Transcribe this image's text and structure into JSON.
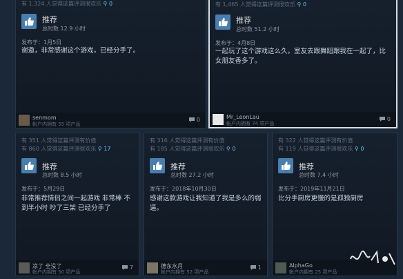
{
  "reviews": [
    {
      "helpful": "有 1,324 人觉得这篇评测很欢乐",
      "award_count": "0",
      "recommend": "推荐",
      "hours": "总时数 12.9 小时",
      "posted": "发布于：1月5日",
      "text": "谢邀，非常感谢这个游戏，已经分手了。",
      "author": "senmom",
      "owned": "帐户内拥有 55 项产品",
      "comments": "0"
    },
    {
      "helpful": "有 1,465 人觉得这篇评测很欢乐",
      "award_count": "0",
      "recommend": "推荐",
      "hours": "总时数 51.2 小时",
      "posted": "发布于：4月8日",
      "text": "一起玩了这个游戏这么久，室友去跟舞蹈跟我在一起了，比女朋友香多了。",
      "author": "Mr_LeonLau",
      "owned": "帐户内拥有 74 项产品",
      "comments": "0"
    },
    {
      "helpful_value": "有 351 人觉得这篇评测有价值",
      "helpful": "有 860 人觉得这篇评测很欢乐",
      "award_count": "17",
      "recommend": "推荐",
      "hours": "总时数 8.5 小时",
      "posted": "发布于：5月29日",
      "text": "非常推荐情侣之间一起游戏 非常棒 不到半小时 吵了三架 已经分手了",
      "author": "凉了 全没了",
      "owned": "帐户内拥有 50 项产品",
      "comments": "7"
    },
    {
      "helpful_value": "有 316 人觉得这篇评测有价值",
      "helpful": "有 185 人觉得这篇评测很欢乐",
      "award_count": "0",
      "recommend": "推荐",
      "hours": "总时数 27.2 小时",
      "posted": "发布于：2018年10月30日",
      "text": "感谢这款游戏让我知道了我是多么的弱逼。",
      "author": "德东水月",
      "owned": "帐户内拥有 52 项产品",
      "comments": "1"
    },
    {
      "helpful_value": "有 322 人觉得这篇评测有价值",
      "helpful": "有 119 人觉得这篇评测很欢乐",
      "award_count": "0",
      "recommend": "推荐",
      "hours": "总时数 7.4 小时",
      "posted": "发布于：2019年11月21日",
      "text": "比分手厨房更慢的是孤独厨房",
      "author": "AlphaGo",
      "owned": "帐户内拥有 25 项产品",
      "comments": "0"
    }
  ],
  "colors": {
    "accent": "#66c0f4",
    "thumb_bg": "#4a7eaf",
    "page_bg": "#1b2838"
  },
  "icons": {
    "recommend": "thumbs-up-icon",
    "award": "award-icon",
    "comment": "comment-icon"
  }
}
